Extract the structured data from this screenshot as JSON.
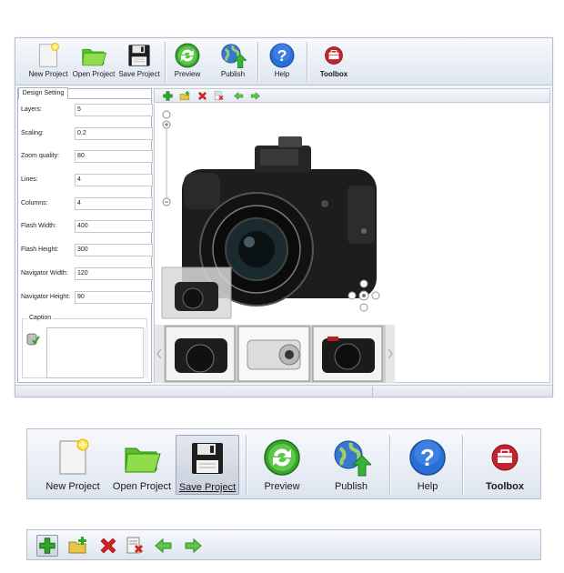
{
  "toolbar": {
    "new_project": "New Project",
    "open_project": "Open Project",
    "save_project": "Save Project",
    "preview": "Preview",
    "publish": "Publish",
    "help": "Help",
    "toolbox": "Toolbox"
  },
  "panel": {
    "tab": "Design Setting",
    "fields": [
      {
        "label": "Layers:",
        "value": "5"
      },
      {
        "label": "Scaling:",
        "value": "0.2"
      },
      {
        "label": "Zoom quality:",
        "value": "80"
      },
      {
        "label": "Lines:",
        "value": "4"
      },
      {
        "label": "Columns:",
        "value": "4"
      },
      {
        "label": "Flash Width:",
        "value": "400"
      },
      {
        "label": "Flash Height:",
        "value": "300"
      },
      {
        "label": "Navigator Width:",
        "value": "120"
      },
      {
        "label": "Navigator Height:",
        "value": "90"
      }
    ],
    "caption_label": "Caption",
    "caption_value": ""
  },
  "big_toolbar": {
    "new_project": "New Project",
    "open_project": "Open Project",
    "save_project": "Save Project",
    "preview": "Preview",
    "publish": "Publish",
    "help": "Help",
    "toolbox": "Toolbox",
    "pressed": "save_project"
  },
  "icons": {
    "new_project": "new-document-icon",
    "open_project": "folder-icon",
    "save_project": "floppy-disk-icon",
    "preview": "refresh-icon",
    "publish": "globe-upload-icon",
    "help": "question-mark-icon",
    "toolbox": "toolbox-icon",
    "add": "plus-icon",
    "add_folder": "add-folder-icon",
    "delete": "delete-icon",
    "delete_item": "delete-item-icon",
    "move_left": "arrow-left-icon",
    "move_right": "arrow-right-icon"
  },
  "colors": {
    "accent_green": "#2fa52a",
    "delete_red": "#d42020",
    "help_blue": "#2a6fd6",
    "toolbox_red": "#c0242c"
  }
}
